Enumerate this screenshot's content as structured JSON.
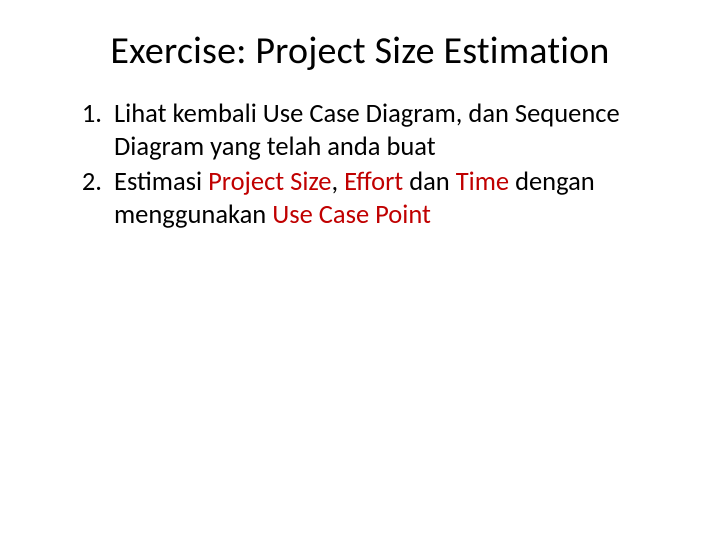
{
  "title": "Exercise: Project Size Estimation",
  "items": [
    {
      "pre": "Lihat kembali Use Case Diagram, dan Sequence Diagram yang telah anda buat"
    },
    {
      "pre": "Estimasi ",
      "hl1": "Project Size",
      "mid1": ", ",
      "hl2": "Effort ",
      "mid2": "dan ",
      "hl3": "Time ",
      "mid3": "dengan menggunakan ",
      "hl4": "Use Case Point"
    }
  ]
}
